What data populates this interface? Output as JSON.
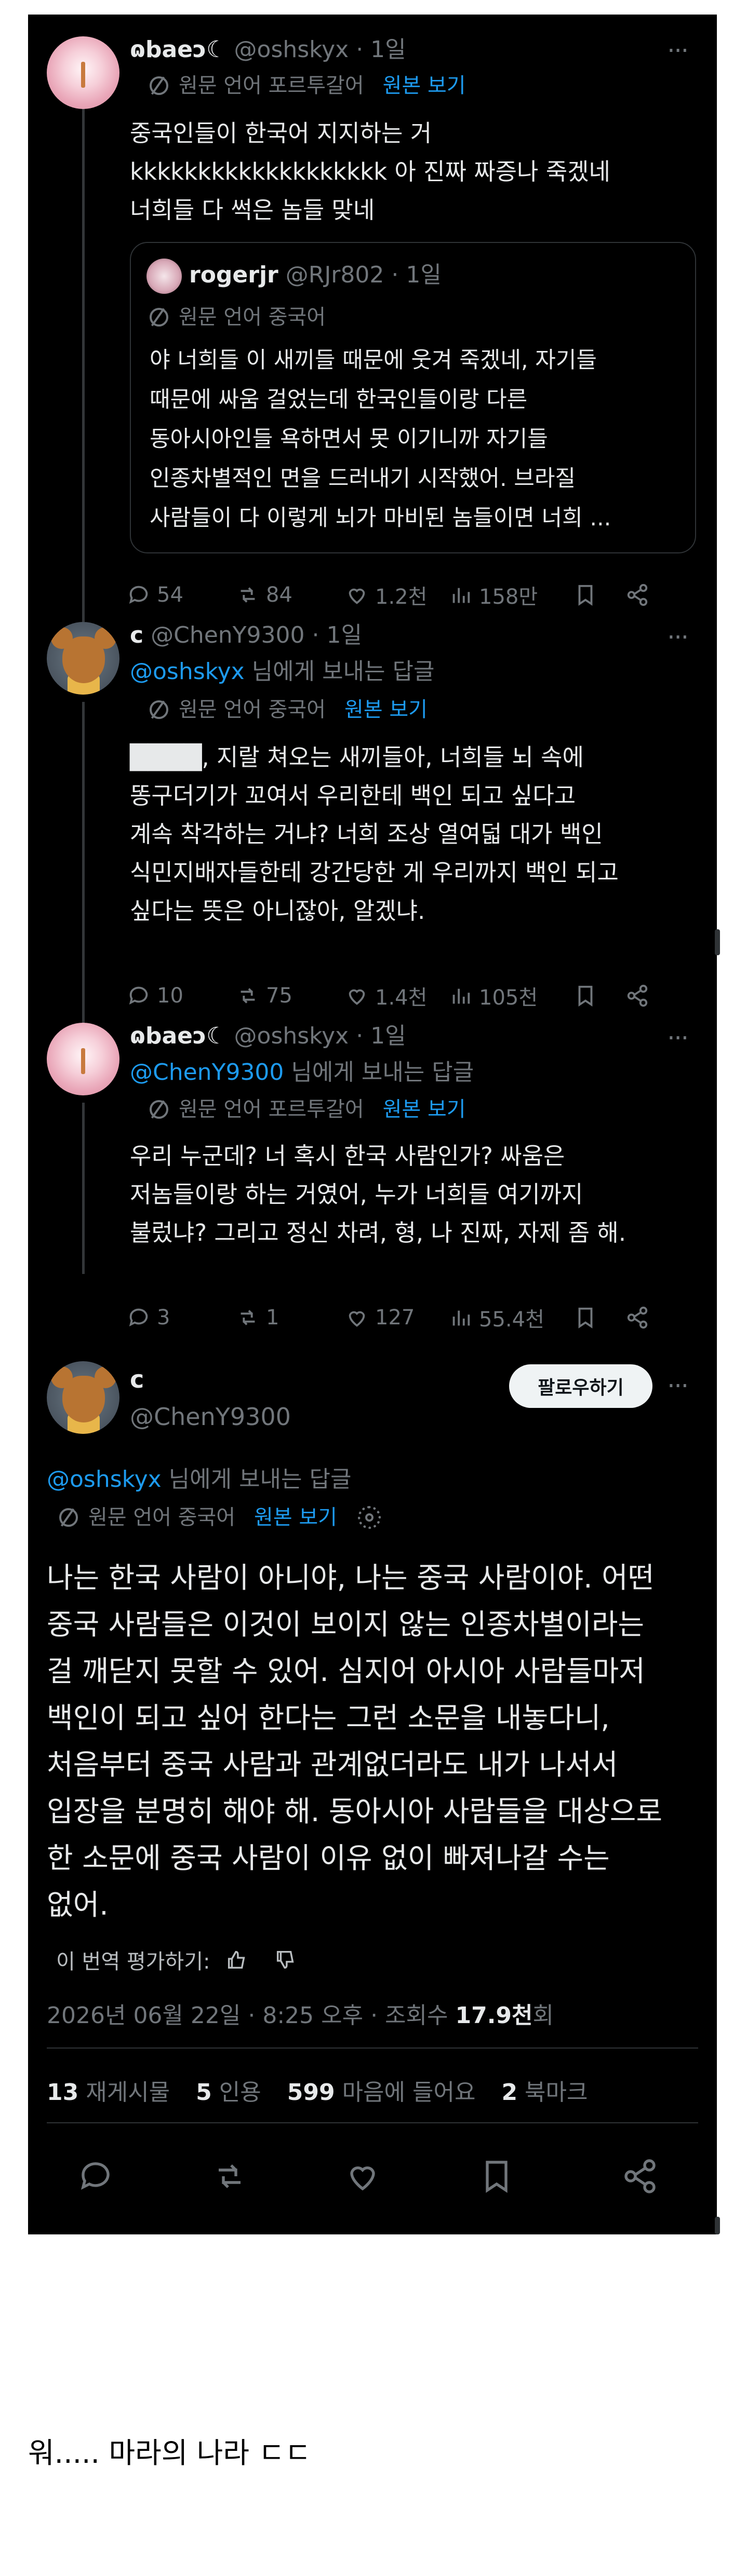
{
  "posts": [
    {
      "display_name": "ɷbaeↄ☾",
      "handle": "@oshskyx",
      "time": "· 1일",
      "translate_label": "원문 언어 포르투갈어",
      "original_label": "원본 보기",
      "lines": [
        "중국인들이 한국어 지지하는 거",
        "kkkkkkkkkkkkkkkkkkk 아 진짜 짜증나 죽겠네",
        "너희들 다 썩은 놈들 맞네"
      ],
      "quote": {
        "display_name": "rogerjr",
        "handle": "@RJr802",
        "time": "· 1일",
        "translate_label": "원문 언어 중국어",
        "lines": [
          "야 너희들 이 새끼들 때문에 웃겨 죽겠네, 자기들",
          "때문에 싸움 걸었는데 한국인들이랑 다른",
          "동아시아인들 욕하면서 못 이기니까 자기들",
          "인종차별적인 면을 드러내기 시작했어. 브라질",
          "사람들이 다 이렇게 뇌가 마비된 놈들이면 너희 ..."
        ]
      },
      "stats": {
        "reply": "54",
        "repost": "84",
        "like": "1.2천",
        "views": "158만"
      }
    },
    {
      "display_name": "c",
      "handle": "@ChenY9300",
      "time": "· 1일",
      "reply_to_mention": "@oshskyx",
      "reply_to_suffix": " 님에게 보내는 답글",
      "translate_label": "원문 언어 중국어",
      "original_label": "원본 보기",
      "lines": [
        "████, 지랄 쳐오는 새끼들아, 너희들 뇌 속에",
        "똥구더기가 꼬여서 우리한테 백인 되고 싶다고",
        "계속 착각하는 거냐? 너희 조상 열여덟 대가 백인",
        "식민지배자들한테 강간당한 게 우리까지 백인 되고",
        "싶다는 뜻은 아니잖아, 알겠냐."
      ],
      "stats": {
        "reply": "10",
        "repost": "75",
        "like": "1.4천",
        "views": "105천"
      }
    },
    {
      "display_name": "ɷbaeↄ☾",
      "handle": "@oshskyx",
      "time": "· 1일",
      "reply_to_mention": "@ChenY9300",
      "reply_to_suffix": " 님에게 보내는 답글",
      "translate_label": "원문 언어 포르투갈어",
      "original_label": "원본 보기",
      "lines": [
        "우리 누군데? 너 혹시 한국 사람인가? 싸움은",
        "저놈들이랑 하는 거였어, 누가 너희들 여기까지",
        "불렀냐? 그리고 정신 차려, 형, 나 진짜, 자제 좀 해."
      ],
      "stats": {
        "reply": "3",
        "repost": "1",
        "like": "127",
        "views": "55.4천"
      }
    }
  ],
  "main": {
    "display_name": "c",
    "handle": "@ChenY9300",
    "follow_label": "팔로우하기",
    "reply_to_mention": "@oshskyx",
    "reply_to_suffix": " 님에게 보내는 답글",
    "translate_label": "원문 언어 중국어",
    "original_label": "원본 보기",
    "lines": [
      "나는 한국 사람이 아니야, 나는 중국 사람이야. 어떤",
      "중국 사람들은 이것이 보이지 않는 인종차별이라는",
      "걸 깨닫지 못할 수 있어. 심지어 아시아 사람들마저",
      "백인이 되고 싶어 한다는 그런 소문을 내놓다니,",
      "처음부터 중국 사람과 관계없더라도 내가 나서서",
      "입장을 분명히 해야 해. 동아시아 사람들을 대상으로",
      "한 소문에 중국 사람이 이유 없이 빠져나갈 수는",
      "없어."
    ],
    "rate_label": "이 번역 평가하기:",
    "date": "2026년 06월 22일 · 8:25 오후 · 조회수 ",
    "views_bold": "17.9천",
    "views_suffix": "회",
    "counts": [
      {
        "num": "13",
        "label": " 재게시물"
      },
      {
        "num": "5",
        "label": " 인용"
      },
      {
        "num": "599",
        "label": " 마음에 들어요"
      },
      {
        "num": "2",
        "label": " 북마크"
      }
    ]
  },
  "footer": "워..... 마라의 나라 ㄷㄷ",
  "colors": {
    "bg": "#000000",
    "text": "#e7e9ea",
    "muted": "#71767b",
    "link": "#1d9bf0",
    "border": "#2f3336"
  }
}
